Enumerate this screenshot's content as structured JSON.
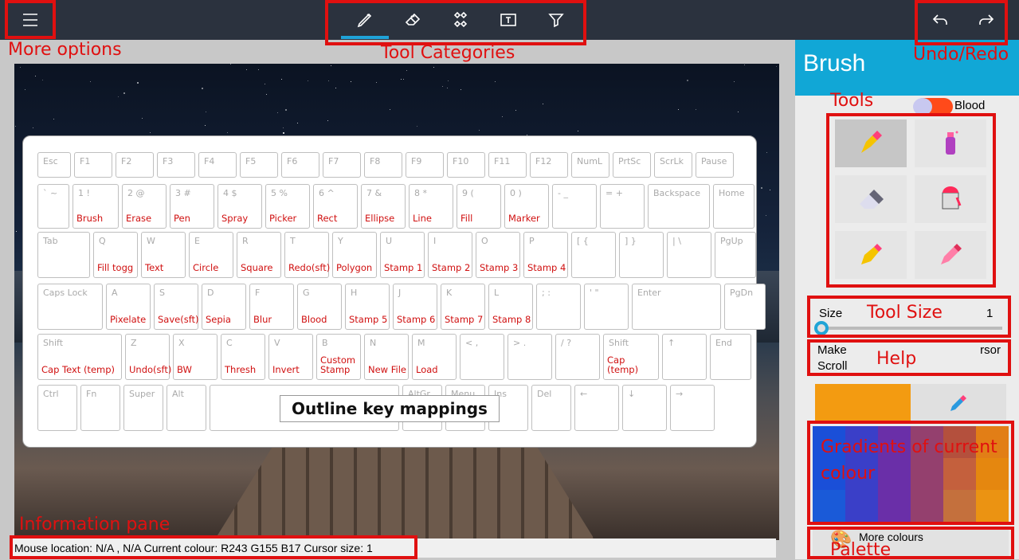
{
  "colors": {
    "toolbar": "#2b323e",
    "accent": "#11a7d6",
    "annotation": "#e01010",
    "current_colour": "#f39b11"
  },
  "topbar": {
    "menu": {
      "icon": "hamburger-icon"
    },
    "categories": [
      {
        "icon": "brush-icon"
      },
      {
        "icon": "eraser-icon"
      },
      {
        "icon": "shapes-icon"
      },
      {
        "icon": "text-icon"
      },
      {
        "icon": "filter-icon"
      }
    ],
    "undo": {
      "icon": "undo-icon"
    },
    "redo": {
      "icon": "redo-icon"
    }
  },
  "keyboard": {
    "title": "Outline key mappings",
    "rows": [
      [
        {
          "k": "Esc",
          "m": ""
        },
        {
          "k": "F1",
          "m": ""
        },
        {
          "k": "F2",
          "m": ""
        },
        {
          "k": "F3",
          "m": ""
        },
        {
          "k": "F4",
          "m": ""
        },
        {
          "k": "F5",
          "m": ""
        },
        {
          "k": "F6",
          "m": ""
        },
        {
          "k": "F7",
          "m": ""
        },
        {
          "k": "F8",
          "m": ""
        },
        {
          "k": "F9",
          "m": ""
        },
        {
          "k": "F10",
          "m": ""
        },
        {
          "k": "F11",
          "m": ""
        },
        {
          "k": "F12",
          "m": ""
        },
        {
          "k": "NumL",
          "m": ""
        },
        {
          "k": "PrtSc",
          "m": ""
        },
        {
          "k": "ScrLk",
          "m": ""
        },
        {
          "k": "Pause",
          "m": ""
        }
      ],
      [
        {
          "k": "` ~",
          "m": ""
        },
        {
          "k": "1 !",
          "m": "Brush"
        },
        {
          "k": "2 @",
          "m": "Erase"
        },
        {
          "k": "3 #",
          "m": "Pen"
        },
        {
          "k": "4 $",
          "m": "Spray"
        },
        {
          "k": "5 %",
          "m": "Picker"
        },
        {
          "k": "6 ^",
          "m": "Rect"
        },
        {
          "k": "7 &",
          "m": "Ellipse"
        },
        {
          "k": "8 *",
          "m": "Line"
        },
        {
          "k": "9 (",
          "m": "Fill"
        },
        {
          "k": "0 )",
          "m": "Marker"
        },
        {
          "k": "- _",
          "m": ""
        },
        {
          "k": "= +",
          "m": ""
        },
        {
          "k": "Backspace",
          "m": ""
        },
        {
          "k": "Home",
          "m": ""
        }
      ],
      [
        {
          "k": "Tab",
          "m": ""
        },
        {
          "k": "Q",
          "m": "Fill togg"
        },
        {
          "k": "W",
          "m": "Text"
        },
        {
          "k": "E",
          "m": "Circle"
        },
        {
          "k": "R",
          "m": "Square"
        },
        {
          "k": "T",
          "m": "Redo(sft)"
        },
        {
          "k": "Y",
          "m": "Polygon"
        },
        {
          "k": "U",
          "m": "Stamp 1"
        },
        {
          "k": "I",
          "m": "Stamp 2"
        },
        {
          "k": "O",
          "m": "Stamp 3"
        },
        {
          "k": "P",
          "m": "Stamp 4"
        },
        {
          "k": "[ {",
          "m": ""
        },
        {
          "k": "] }",
          "m": ""
        },
        {
          "k": "| \\",
          "m": ""
        },
        {
          "k": "PgUp",
          "m": ""
        }
      ],
      [
        {
          "k": "Caps Lock",
          "m": ""
        },
        {
          "k": "A",
          "m": "Pixelate"
        },
        {
          "k": "S",
          "m": "Save(sft)"
        },
        {
          "k": "D",
          "m": "Sepia"
        },
        {
          "k": "F",
          "m": "Blur"
        },
        {
          "k": "G",
          "m": "Blood"
        },
        {
          "k": "H",
          "m": "Stamp 5"
        },
        {
          "k": "J",
          "m": "Stamp 6"
        },
        {
          "k": "K",
          "m": "Stamp 7"
        },
        {
          "k": "L",
          "m": "Stamp 8"
        },
        {
          "k": "; :",
          "m": ""
        },
        {
          "k": "' \"",
          "m": ""
        },
        {
          "k": "Enter",
          "m": ""
        },
        {
          "k": "PgDn",
          "m": ""
        }
      ],
      [
        {
          "k": "Shift",
          "m": "Cap Text (temp)"
        },
        {
          "k": "Z",
          "m": "Undo(sft)"
        },
        {
          "k": "X",
          "m": "BW"
        },
        {
          "k": "C",
          "m": "Thresh"
        },
        {
          "k": "V",
          "m": "Invert"
        },
        {
          "k": "B",
          "m": "Custom Stamp"
        },
        {
          "k": "N",
          "m": "New File"
        },
        {
          "k": "M",
          "m": "Load"
        },
        {
          "k": "< ,",
          "m": ""
        },
        {
          "k": "> .",
          "m": ""
        },
        {
          "k": "/ ?",
          "m": ""
        },
        {
          "k": "Shift",
          "m": "Cap (temp)"
        },
        {
          "k": "↑",
          "m": ""
        },
        {
          "k": "End",
          "m": ""
        }
      ],
      [
        {
          "k": "Ctrl",
          "m": ""
        },
        {
          "k": "Fn",
          "m": ""
        },
        {
          "k": "Super",
          "m": ""
        },
        {
          "k": "Alt",
          "m": ""
        },
        {
          "k": "",
          "m": ""
        },
        {
          "k": "AltGr",
          "m": ""
        },
        {
          "k": "Menu",
          "m": ""
        },
        {
          "k": "Ins",
          "m": ""
        },
        {
          "k": "Del",
          "m": ""
        },
        {
          "k": "←",
          "m": ""
        },
        {
          "k": "↓",
          "m": ""
        },
        {
          "k": "→",
          "m": ""
        }
      ]
    ]
  },
  "info": {
    "text": "Mouse location: N/A , N/A Current colour: R243 G155 B17 Cursor size: 1"
  },
  "panel": {
    "title": "Brush",
    "blood_label": "Blood",
    "tools": [
      {
        "icon": "brush-icon"
      },
      {
        "icon": "spray-can-icon"
      },
      {
        "icon": "eraser-icon"
      },
      {
        "icon": "fill-bucket-icon"
      },
      {
        "icon": "pen-nib-icon"
      },
      {
        "icon": "marker-icon"
      }
    ],
    "size_label": "Size",
    "size_value": "1",
    "size_fraction": 0,
    "help_line1": "Make",
    "help_line1_end": "rsor",
    "help_line2": "Scroll",
    "gradient": [
      "#1a4fd8",
      "#3a3fc8",
      "#6a2fa8",
      "#94406e",
      "#b4503d",
      "#e27e16",
      "#1a4fd8",
      "#3a3fc8",
      "#6a2fa8",
      "#94406e",
      "#c4603d",
      "#e5870f",
      "#1a5ad8",
      "#3a3fc8",
      "#6a2fa8",
      "#94406e",
      "#c4703d",
      "#eb9312"
    ],
    "more_colours": "More colours"
  },
  "annotations": {
    "more_options": "More options",
    "tool_categories": "Tool Categories",
    "undo_redo": "Undo/Redo",
    "tools": "Tools",
    "tool_size": "Tool Size",
    "help": "Help",
    "gradients": "Gradients of current colour",
    "information_pane": "Information pane",
    "palette": "Palette"
  }
}
